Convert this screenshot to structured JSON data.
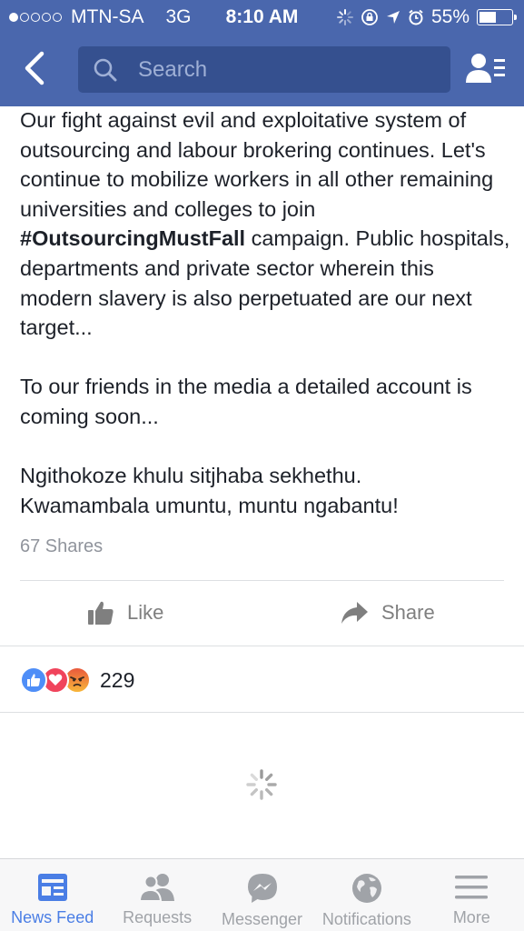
{
  "status_bar": {
    "carrier": "MTN-SA",
    "network": "3G",
    "time": "8:10 AM",
    "battery": "55%",
    "battery_level": 0.55
  },
  "header": {
    "search_placeholder": "Search",
    "icons": {
      "back": "back-chevron-icon",
      "search": "search-icon",
      "friends": "friends-list-icon"
    },
    "background_color": "#4a67ad"
  },
  "post": {
    "paragraph1_before": "Our fight against evil and exploitative system of outsourcing and labour brokering continues. Let's continue to mobilize workers in all other remaining universities and colleges to join ",
    "hashtag": "#OutsourcingMustFall",
    "paragraph1_after": " campaign. Public hospitals, departments and private sector wherein this modern slavery is also perpetuated are our next target...",
    "paragraph2": "To our friends in the media a detailed account is coming soon...",
    "paragraph3_line1": "Ngithokoze khulu sitjhaba sekhethu.",
    "paragraph3_line2": "Kwamambala umuntu, muntu ngabantu!",
    "shares": "67 Shares"
  },
  "actions": {
    "like_label": "Like",
    "share_label": "Share"
  },
  "reactions": {
    "icons": [
      "like-reaction-icon",
      "love-reaction-icon",
      "angry-reaction-icon"
    ],
    "count": "229"
  },
  "tabbar": {
    "tabs": [
      {
        "label": "News Feed",
        "icon": "news-feed-icon",
        "active": true
      },
      {
        "label": "Requests",
        "icon": "friend-requests-icon",
        "active": false
      },
      {
        "label": "Messenger",
        "icon": "messenger-icon",
        "active": false
      },
      {
        "label": "Notifications",
        "icon": "globe-icon",
        "active": false
      },
      {
        "label": "More",
        "icon": "menu-icon",
        "active": false
      }
    ],
    "active_color": "#4a7ee5",
    "inactive_color": "#a0a3a8"
  }
}
